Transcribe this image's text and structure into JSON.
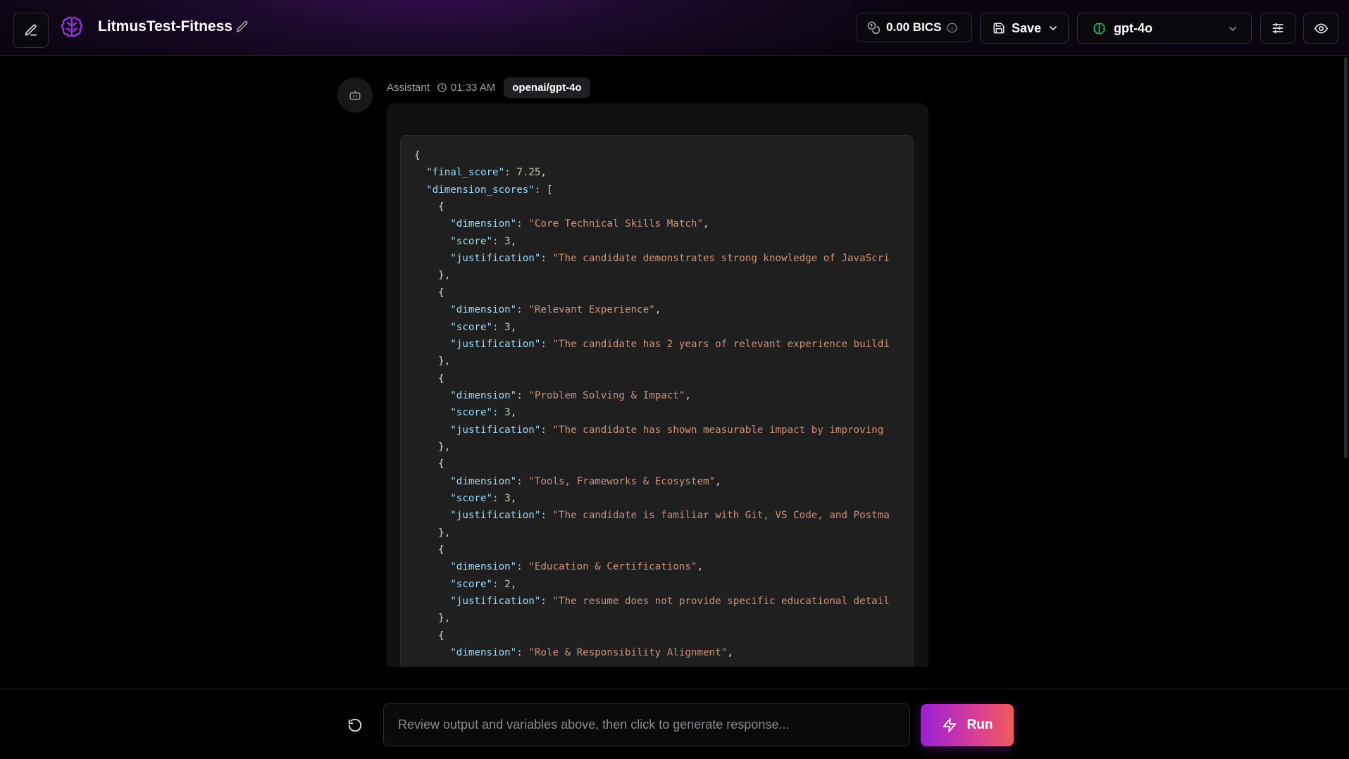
{
  "header": {
    "app_title": "LitmusTest-Fitness",
    "bics_value": "0.00 BICS",
    "save_label": "Save",
    "model_name": "gpt-4o",
    "icons": [
      "pencil-icon",
      "brain-logo-icon",
      "coins-icon",
      "info-icon",
      "floppy-disk-icon",
      "chevron-down-icon",
      "sliders-icon",
      "eye-icon"
    ]
  },
  "message": {
    "role": "Assistant",
    "time": "01:33 AM",
    "model_tag": "openai/gpt-4o",
    "code_lines": [
      [
        [
          "p",
          "{"
        ]
      ],
      [
        [
          "p",
          "  "
        ],
        [
          "k",
          "\"final_score\""
        ],
        [
          "p",
          ": "
        ],
        [
          "n",
          "7.25"
        ],
        [
          "p",
          ","
        ]
      ],
      [
        [
          "p",
          "  "
        ],
        [
          "k",
          "\"dimension_scores\""
        ],
        [
          "p",
          ": ["
        ]
      ],
      [
        [
          "p",
          "    {"
        ]
      ],
      [
        [
          "p",
          "      "
        ],
        [
          "k",
          "\"dimension\""
        ],
        [
          "p",
          ": "
        ],
        [
          "s",
          "\"Core Technical Skills Match\""
        ],
        [
          "p",
          ","
        ]
      ],
      [
        [
          "p",
          "      "
        ],
        [
          "k",
          "\"score\""
        ],
        [
          "p",
          ": "
        ],
        [
          "n",
          "3"
        ],
        [
          "p",
          ","
        ]
      ],
      [
        [
          "p",
          "      "
        ],
        [
          "k",
          "\"justification\""
        ],
        [
          "p",
          ": "
        ],
        [
          "s",
          "\"The candidate demonstrates strong knowledge of JavaScri"
        ]
      ],
      [
        [
          "p",
          "    },"
        ]
      ],
      [
        [
          "p",
          "    {"
        ]
      ],
      [
        [
          "p",
          "      "
        ],
        [
          "k",
          "\"dimension\""
        ],
        [
          "p",
          ": "
        ],
        [
          "s",
          "\"Relevant Experience\""
        ],
        [
          "p",
          ","
        ]
      ],
      [
        [
          "p",
          "      "
        ],
        [
          "k",
          "\"score\""
        ],
        [
          "p",
          ": "
        ],
        [
          "n",
          "3"
        ],
        [
          "p",
          ","
        ]
      ],
      [
        [
          "p",
          "      "
        ],
        [
          "k",
          "\"justification\""
        ],
        [
          "p",
          ": "
        ],
        [
          "s",
          "\"The candidate has 2 years of relevant experience buildi"
        ]
      ],
      [
        [
          "p",
          "    },"
        ]
      ],
      [
        [
          "p",
          "    {"
        ]
      ],
      [
        [
          "p",
          "      "
        ],
        [
          "k",
          "\"dimension\""
        ],
        [
          "p",
          ": "
        ],
        [
          "s",
          "\"Problem Solving & Impact\""
        ],
        [
          "p",
          ","
        ]
      ],
      [
        [
          "p",
          "      "
        ],
        [
          "k",
          "\"score\""
        ],
        [
          "p",
          ": "
        ],
        [
          "n",
          "3"
        ],
        [
          "p",
          ","
        ]
      ],
      [
        [
          "p",
          "      "
        ],
        [
          "k",
          "\"justification\""
        ],
        [
          "p",
          ": "
        ],
        [
          "s",
          "\"The candidate has shown measurable impact by improving "
        ]
      ],
      [
        [
          "p",
          "    },"
        ]
      ],
      [
        [
          "p",
          "    {"
        ]
      ],
      [
        [
          "p",
          "      "
        ],
        [
          "k",
          "\"dimension\""
        ],
        [
          "p",
          ": "
        ],
        [
          "s",
          "\"Tools, Frameworks & Ecosystem\""
        ],
        [
          "p",
          ","
        ]
      ],
      [
        [
          "p",
          "      "
        ],
        [
          "k",
          "\"score\""
        ],
        [
          "p",
          ": "
        ],
        [
          "n",
          "3"
        ],
        [
          "p",
          ","
        ]
      ],
      [
        [
          "p",
          "      "
        ],
        [
          "k",
          "\"justification\""
        ],
        [
          "p",
          ": "
        ],
        [
          "s",
          "\"The candidate is familiar with Git, VS Code, and Postma"
        ]
      ],
      [
        [
          "p",
          "    },"
        ]
      ],
      [
        [
          "p",
          "    {"
        ]
      ],
      [
        [
          "p",
          "      "
        ],
        [
          "k",
          "\"dimension\""
        ],
        [
          "p",
          ": "
        ],
        [
          "s",
          "\"Education & Certifications\""
        ],
        [
          "p",
          ","
        ]
      ],
      [
        [
          "p",
          "      "
        ],
        [
          "k",
          "\"score\""
        ],
        [
          "p",
          ": "
        ],
        [
          "n",
          "2"
        ],
        [
          "p",
          ","
        ]
      ],
      [
        [
          "p",
          "      "
        ],
        [
          "k",
          "\"justification\""
        ],
        [
          "p",
          ": "
        ],
        [
          "s",
          "\"The resume does not provide specific educational detail"
        ]
      ],
      [
        [
          "p",
          "    },"
        ]
      ],
      [
        [
          "p",
          "    {"
        ]
      ],
      [
        [
          "p",
          "      "
        ],
        [
          "k",
          "\"dimension\""
        ],
        [
          "p",
          ": "
        ],
        [
          "s",
          "\"Role & Responsibility Alignment\""
        ],
        [
          "p",
          ","
        ]
      ]
    ]
  },
  "composer": {
    "placeholder": "Review output and variables above, then click to generate response...",
    "run_label": "Run"
  },
  "colors": {
    "accent_purple": "#9b1fd6",
    "accent_coral": "#f25a5a",
    "json_key": "#9cdcfe",
    "json_string": "#ce9178",
    "json_number": "#b5cea8",
    "model_icon_green": "#22c55e"
  }
}
